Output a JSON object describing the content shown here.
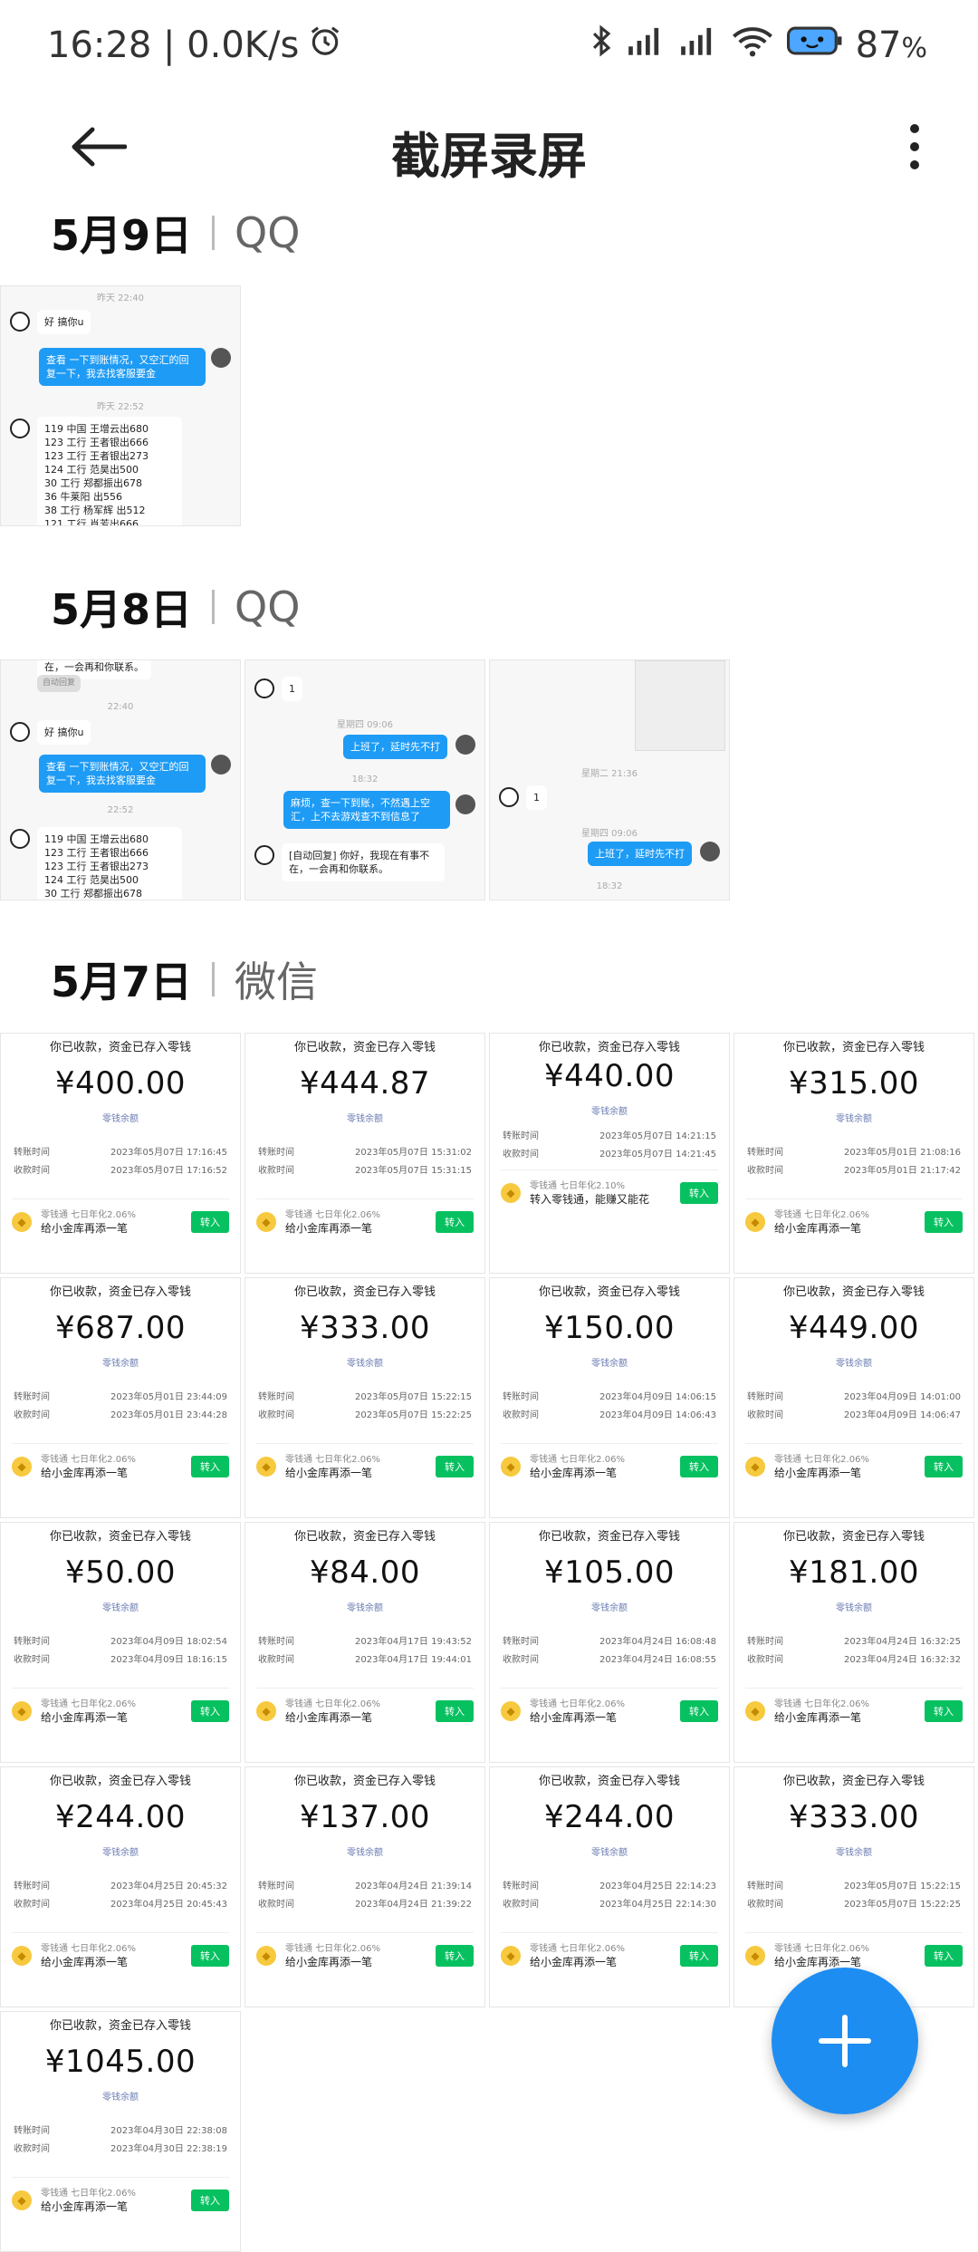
{
  "status": {
    "time": "16:28 | 0.0K/s",
    "battery": "87"
  },
  "header": {
    "title": "截屏录屏"
  },
  "sections": [
    {
      "date": "5月9日",
      "source": "QQ"
    },
    {
      "date": "5月8日",
      "source": "QQ"
    },
    {
      "date": "5月7日",
      "source": "微信"
    }
  ],
  "chat": {
    "ts_yesterday_2240": "昨天 22:40",
    "ts_yesterday_2252": "昨天 22:52",
    "ts_2240": "22:40",
    "ts_2252": "22:52",
    "ts_mon_0906": "星期四 09:06",
    "ts_1832": "18:32",
    "ts_tue_2136": "星期二 21:36",
    "reply_hao": "好 搞你u",
    "msg_check": "查看 一下到账情况，又空汇的回复一下，我去找客服要金",
    "list": "119 中国 王增云出680\n123 工行 王者银出666\n123 工行 王者银出273\n 124 工行 范昊出500\n 30 工行 郑都振出678\n36 牛莱阳 出556\n38 工行 杨军辉 出512\n121 工行 肖芳出666",
    "list_short": "119 中国 王增云出680\n123 工行 王者银出666\n123 工行 王者银出273\n 124 工行 范昊出500\n 30 工行 郑都振出678",
    "msg_1": "1",
    "msg_work": "上班了，延时先不打",
    "msg_trouble": "麻烦，查一下到账，不然遇上空汇，上不去游戏查不到信息了",
    "msg_auto": "[自动回复] 你好，我现在有事不在，一会再和你联系。",
    "auto_tag": "自动回复",
    "top_cut": "在，一会再和你联系。"
  },
  "pay_common": {
    "header": "你已收款，资金已存入零钱",
    "balance": "零钱余额",
    "transfer_label": "转账时间",
    "receive_label": "收款时间",
    "promo_small": "零钱通 七日年化2.06%",
    "promo_main": "给小金库再添一笔",
    "promo_small_alt": "零钱通 七日年化2.10%",
    "promo_main_alt": "转入零钱通，能赚又能花",
    "button": "转入"
  },
  "payments": [
    {
      "amount": "¥400.00",
      "t1": "2023年05月07日 17:16:45",
      "t2": "2023年05月07日 17:16:52"
    },
    {
      "amount": "¥444.87",
      "t1": "2023年05月07日 15:31:02",
      "t2": "2023年05月07日 15:31:15"
    },
    {
      "amount": "¥440.00",
      "t1": "2023年05月07日 14:21:15",
      "t2": "2023年05月07日 14:21:45"
    },
    {
      "amount": "¥315.00",
      "t1": "2023年05月01日 21:08:16",
      "t2": "2023年05月01日 21:17:42"
    },
    {
      "amount": "¥687.00",
      "t1": "2023年05月01日 23:44:09",
      "t2": "2023年05月01日 23:44:28"
    },
    {
      "amount": "¥333.00",
      "t1": "2023年05月07日 15:22:15",
      "t2": "2023年05月07日 15:22:25"
    },
    {
      "amount": "¥150.00",
      "t1": "2023年04月09日 14:06:15",
      "t2": "2023年04月09日 14:06:43"
    },
    {
      "amount": "¥449.00",
      "t1": "2023年04月09日 14:01:00",
      "t2": "2023年04月09日 14:06:47"
    },
    {
      "amount": "¥50.00",
      "t1": "2023年04月09日 18:02:54",
      "t2": "2023年04月09日 18:16:15"
    },
    {
      "amount": "¥84.00",
      "t1": "2023年04月17日 19:43:52",
      "t2": "2023年04月17日 19:44:01"
    },
    {
      "amount": "¥105.00",
      "t1": "2023年04月24日 16:08:48",
      "t2": "2023年04月24日 16:08:55"
    },
    {
      "amount": "¥181.00",
      "t1": "2023年04月24日 16:32:25",
      "t2": "2023年04月24日 16:32:32"
    },
    {
      "amount": "¥244.00",
      "t1": "2023年04月25日 20:45:32",
      "t2": "2023年04月25日 20:45:43"
    },
    {
      "amount": "¥137.00",
      "t1": "2023年04月24日 21:39:14",
      "t2": "2023年04月24日 21:39:22"
    },
    {
      "amount": "¥244.00",
      "t1": "2023年04月25日 22:14:23",
      "t2": "2023年04月25日 22:14:30"
    },
    {
      "amount": "¥333.00",
      "t1": "2023年05月07日 15:22:15",
      "t2": "2023年05月07日 15:22:25"
    },
    {
      "amount": "¥1045.00",
      "t1": "2023年04月30日 22:38:08",
      "t2": "2023年04月30日 22:38:19"
    }
  ],
  "colors": {
    "fab": "#1e8df2",
    "wechat_green": "#07c160",
    "qq_blue": "#1e9bf5"
  }
}
